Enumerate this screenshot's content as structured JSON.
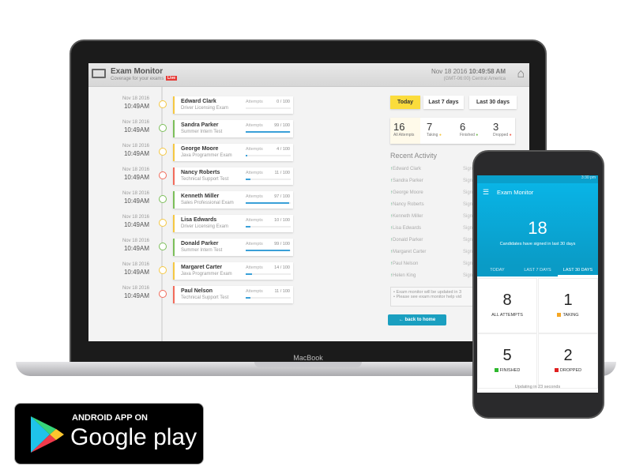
{
  "laptop": {
    "brand": "MacBook"
  },
  "app": {
    "title": "Exam Monitor",
    "subtitle": "Coverage for your exams",
    "live_badge": "Live",
    "date": "Nov 18 2016",
    "time": "10:49:58 AM",
    "timezone": "(GMT-06:00) Central America",
    "home_icon": "home-icon"
  },
  "timeline": [
    {
      "date": "Nov 18 2016",
      "time": "10:49AM",
      "name": "Edward Clark",
      "exam": "Driver Licensing Exam",
      "attempts_label": "Attempts",
      "attempts": "0 / 100",
      "progress": 0,
      "color": "#f5c842"
    },
    {
      "date": "Nov 18 2016",
      "time": "10:49AM",
      "name": "Sandra Parker",
      "exam": "Summer Intern Test",
      "attempts_label": "Attempts",
      "attempts": "99 / 100",
      "progress": 99,
      "color": "#7cbf5a"
    },
    {
      "date": "Nov 18 2016",
      "time": "10:49AM",
      "name": "George Moore",
      "exam": "Java Programmer Exam",
      "attempts_label": "Attempts",
      "attempts": "4 / 100",
      "progress": 4,
      "color": "#f5c842"
    },
    {
      "date": "Nov 18 2016",
      "time": "10:49AM",
      "name": "Nancy Roberts",
      "exam": "Technical Support Test",
      "attempts_label": "Attempts",
      "attempts": "11 / 100",
      "progress": 11,
      "color": "#f26b5b"
    },
    {
      "date": "Nov 18 2016",
      "time": "10:49AM",
      "name": "Kenneth Miller",
      "exam": "Sales Professional Exam",
      "attempts_label": "Attempts",
      "attempts": "97 / 100",
      "progress": 97,
      "color": "#7cbf5a"
    },
    {
      "date": "Nov 18 2016",
      "time": "10:49AM",
      "name": "Lisa Edwards",
      "exam": "Driver Licensing Exam",
      "attempts_label": "Attempts",
      "attempts": "10 / 100",
      "progress": 10,
      "color": "#f5c842"
    },
    {
      "date": "Nov 18 2016",
      "time": "10:49AM",
      "name": "Donald Parker",
      "exam": "Summer Intern Test",
      "attempts_label": "Attempts",
      "attempts": "99 / 100",
      "progress": 99,
      "color": "#7cbf5a"
    },
    {
      "date": "Nov 18 2016",
      "time": "10:49AM",
      "name": "Margaret Carter",
      "exam": "Java Programmer Exam",
      "attempts_label": "Attempts",
      "attempts": "14 / 100",
      "progress": 14,
      "color": "#f5c842"
    },
    {
      "date": "Nov 18 2016",
      "time": "10:49AM",
      "name": "Paul Nelson",
      "exam": "Technical Support Test",
      "attempts_label": "Attempts",
      "attempts": "11 / 100",
      "progress": 11,
      "color": "#f26b5b"
    }
  ],
  "filters": [
    "Today",
    "Last 7 days",
    "Last 30 days"
  ],
  "stats": [
    {
      "value": "16",
      "label": "All Attempts"
    },
    {
      "value": "7",
      "label": "Taking",
      "color": "#f5c842"
    },
    {
      "value": "6",
      "label": "Finished",
      "color": "#7cbf5a"
    },
    {
      "value": "3",
      "label": "Dropped",
      "color": "#f26b5b"
    }
  ],
  "recent": {
    "title": "Recent Activity",
    "items": [
      "Edward Clark",
      "Sandra Parker",
      "George Moore",
      "Nancy Roberts",
      "Kenneth Miller",
      "Lisa Edwards",
      "Donald Parker",
      "Margaret Carter",
      "Paul Nelson",
      "Helen King"
    ],
    "status": "Sign"
  },
  "notes": [
    "Exam monitor will be updated in 3",
    "Please see exam monitor help vid"
  ],
  "back_button": "back to home",
  "phone": {
    "clock": "3:30 pm",
    "title": "Exam Monitor",
    "count": "18",
    "count_label": "Candidates have signed in last 30 days",
    "tabs": [
      "TODAY",
      "LAST 7 DAYS",
      "LAST 30 DAYS"
    ],
    "active_tab": 2,
    "cells": [
      {
        "value": "8",
        "label": "ALL ATTEMPTS"
      },
      {
        "value": "1",
        "label": "TAKING",
        "color": "#f5a623"
      },
      {
        "value": "5",
        "label": "FINISHED",
        "color": "#2eb82e"
      },
      {
        "value": "2",
        "label": "DROPPED",
        "color": "#e02020"
      }
    ],
    "footer": "Updating in 23 seconds"
  },
  "badge": {
    "top": "ANDROID APP ON",
    "main": "Google play"
  }
}
